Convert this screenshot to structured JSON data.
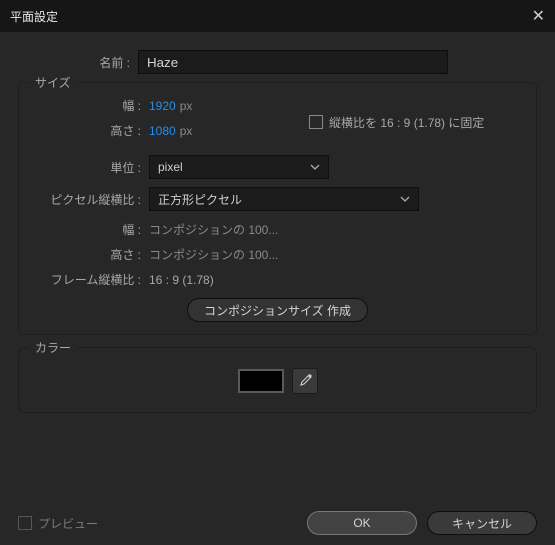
{
  "title": "平面設定",
  "labels": {
    "name": "名前 :",
    "size": "サイズ",
    "width": "幅 :",
    "height": "高さ :",
    "units": "単位 :",
    "pixelAR": "ピクセル縦横比 :",
    "hintWidth": "幅 :",
    "hintHeight": "高さ :",
    "hintWidthVal": "コンポジションの 100...",
    "hintHeightVal": "コンポジションの 100...",
    "frameAR": "フレーム縦横比 :",
    "frameARVal": "16 : 9 (1.78)",
    "lockAR": "縦横比を 16 : 9 (1.78) に固定",
    "makeCompSize": "コンポジションサイズ 作成",
    "color": "カラー",
    "preview": "プレビュー",
    "ok": "OK",
    "cancel": "キャンセル"
  },
  "values": {
    "name": "Haze",
    "width": "1920",
    "height": "1080",
    "px": "px",
    "units": "pixel",
    "pixelAR": "正方形ピクセル",
    "color": "#000000"
  }
}
